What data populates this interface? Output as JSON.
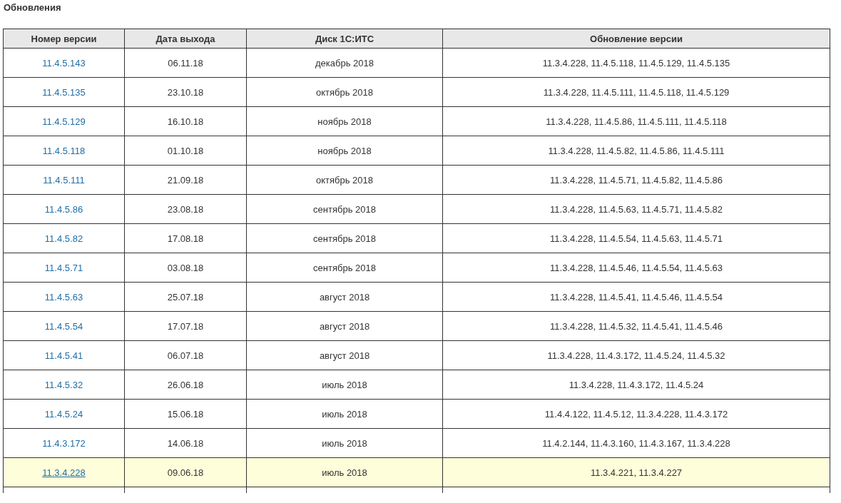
{
  "title": "Обновления",
  "table": {
    "columns": [
      "Номер версии",
      "Дата выхода",
      "Диск 1С:ИТС",
      "Обновление версии"
    ],
    "rows": [
      {
        "version": "11.4.5.143",
        "date": "06.11.18",
        "disk": "декабрь 2018",
        "updates": "11.3.4.228, 11.4.5.118, 11.4.5.129, 11.4.5.135",
        "selected": false
      },
      {
        "version": "11.4.5.135",
        "date": "23.10.18",
        "disk": "октябрь 2018",
        "updates": "11.3.4.228, 11.4.5.111, 11.4.5.118, 11.4.5.129",
        "selected": false
      },
      {
        "version": "11.4.5.129",
        "date": "16.10.18",
        "disk": "ноябрь 2018",
        "updates": "11.3.4.228, 11.4.5.86, 11.4.5.111, 11.4.5.118",
        "selected": false
      },
      {
        "version": "11.4.5.118",
        "date": "01.10.18",
        "disk": "ноябрь 2018",
        "updates": "11.3.4.228, 11.4.5.82, 11.4.5.86, 11.4.5.111",
        "selected": false
      },
      {
        "version": "11.4.5.111",
        "date": "21.09.18",
        "disk": "октябрь 2018",
        "updates": "11.3.4.228, 11.4.5.71, 11.4.5.82, 11.4.5.86",
        "selected": false
      },
      {
        "version": "11.4.5.86",
        "date": "23.08.18",
        "disk": "сентябрь 2018",
        "updates": "11.3.4.228, 11.4.5.63, 11.4.5.71, 11.4.5.82",
        "selected": false
      },
      {
        "version": "11.4.5.82",
        "date": "17.08.18",
        "disk": "сентябрь 2018",
        "updates": "11.3.4.228, 11.4.5.54, 11.4.5.63, 11.4.5.71",
        "selected": false
      },
      {
        "version": "11.4.5.71",
        "date": "03.08.18",
        "disk": "сентябрь 2018",
        "updates": "11.3.4.228, 11.4.5.46, 11.4.5.54, 11.4.5.63",
        "selected": false
      },
      {
        "version": "11.4.5.63",
        "date": "25.07.18",
        "disk": "август 2018",
        "updates": "11.3.4.228, 11.4.5.41, 11.4.5.46, 11.4.5.54",
        "selected": false
      },
      {
        "version": "11.4.5.54",
        "date": "17.07.18",
        "disk": "август 2018",
        "updates": "11.3.4.228, 11.4.5.32, 11.4.5.41, 11.4.5.46",
        "selected": false
      },
      {
        "version": "11.4.5.41",
        "date": "06.07.18",
        "disk": "август 2018",
        "updates": "11.3.4.228, 11.4.3.172, 11.4.5.24, 11.4.5.32",
        "selected": false
      },
      {
        "version": "11.4.5.32",
        "date": "26.06.18",
        "disk": "июль 2018",
        "updates": "11.3.4.228, 11.4.3.172, 11.4.5.24",
        "selected": false
      },
      {
        "version": "11.4.5.24",
        "date": "15.06.18",
        "disk": "июль 2018",
        "updates": "11.4.4.122, 11.4.5.12, 11.3.4.228, 11.4.3.172",
        "selected": false
      },
      {
        "version": "11.4.3.172",
        "date": "14.06.18",
        "disk": "июль 2018",
        "updates": "11.4.2.144, 11.4.3.160, 11.4.3.167, 11.3.4.228",
        "selected": false
      },
      {
        "version": "11.3.4.228",
        "date": "09.06.18",
        "disk": "июль 2018",
        "updates": "11.3.4.221, 11.3.4.227",
        "selected": true
      }
    ]
  }
}
